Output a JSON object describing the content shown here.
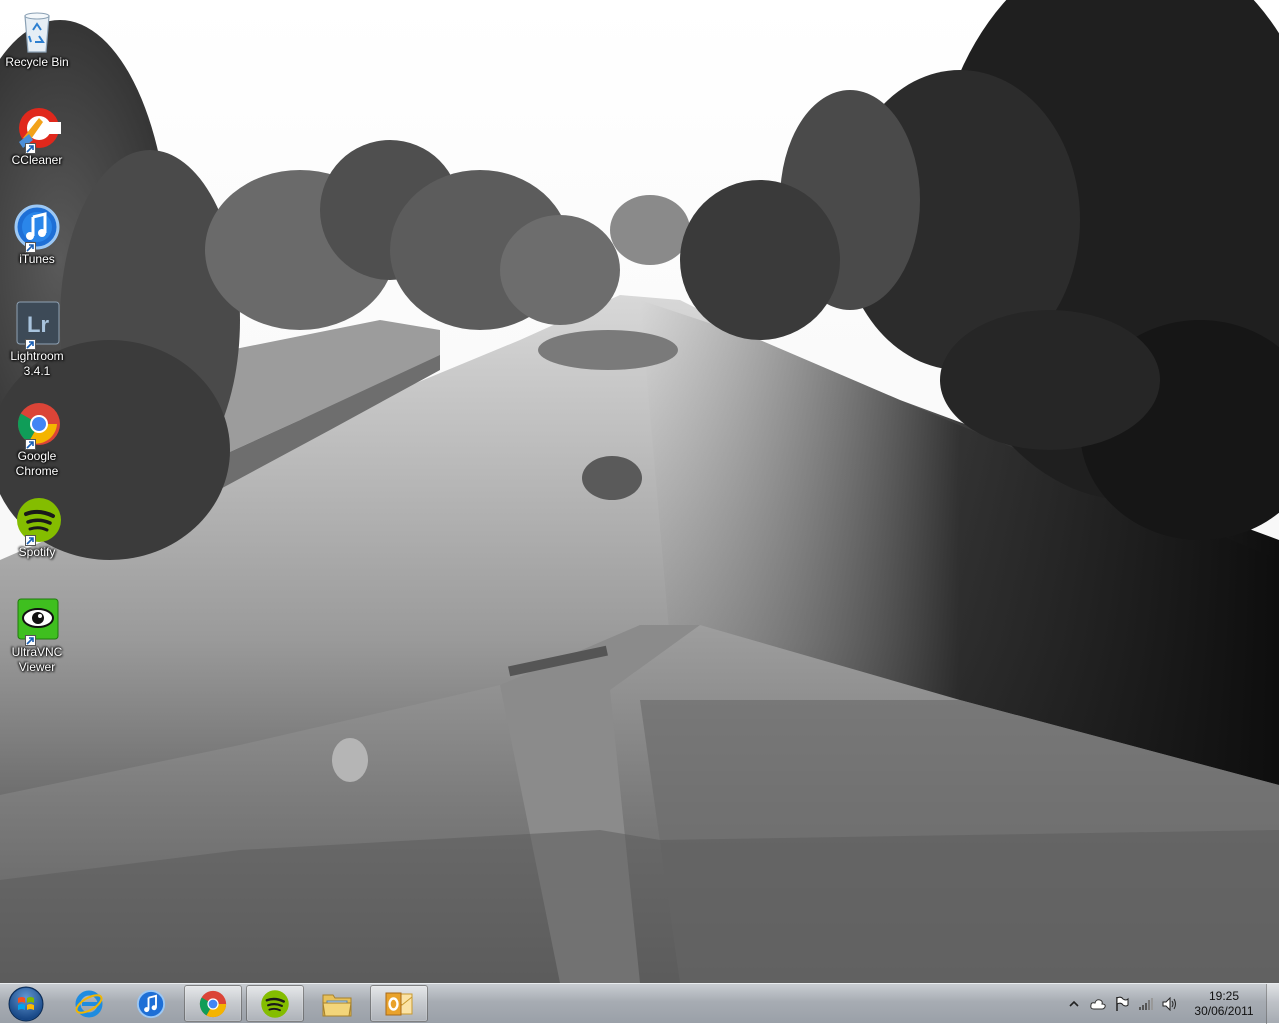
{
  "desktop": {
    "icons": [
      {
        "label": "Recycle Bin",
        "icon": "recycle-bin-icon"
      },
      {
        "label": "CCleaner",
        "icon": "ccleaner-icon"
      },
      {
        "label": "iTunes",
        "icon": "itunes-icon"
      },
      {
        "label": "Lightroom\n3.4.1",
        "icon": "lightroom-icon",
        "glyph": "Lr"
      },
      {
        "label": "Google\nChrome",
        "icon": "chrome-icon"
      },
      {
        "label": "Spotify",
        "icon": "spotify-icon"
      },
      {
        "label": "UltraVNC\nViewer",
        "icon": "ultravnc-icon"
      }
    ]
  },
  "taskbar": {
    "start_icon": "windows-start-icon",
    "pinned": [
      {
        "name": "internet-explorer",
        "icon": "ie-icon",
        "open": false
      },
      {
        "name": "itunes",
        "icon": "itunes-icon",
        "open": false
      },
      {
        "name": "google-chrome",
        "icon": "chrome-icon",
        "open": true
      },
      {
        "name": "spotify",
        "icon": "spotify-icon",
        "open": true
      },
      {
        "name": "windows-explorer",
        "icon": "folder-icon",
        "open": false
      },
      {
        "name": "outlook",
        "icon": "outlook-icon",
        "open": true
      }
    ],
    "tray": {
      "icons": [
        "show-hidden-icons-arrow",
        "cloud-icon",
        "action-center-flag-icon",
        "network-signal-icon",
        "volume-icon"
      ],
      "time": "19:25",
      "date": "30/06/2011"
    }
  },
  "colors": {
    "chrome_red": "#db4437",
    "chrome_green": "#0f9d58",
    "chrome_yellow": "#f4b400",
    "chrome_blue": "#4285f4",
    "spotify_green": "#84bd00",
    "vnc_green": "#3fbf1f",
    "itunes_blue": "#1e6fd6",
    "lightroom_bg": "#3d4a57"
  }
}
